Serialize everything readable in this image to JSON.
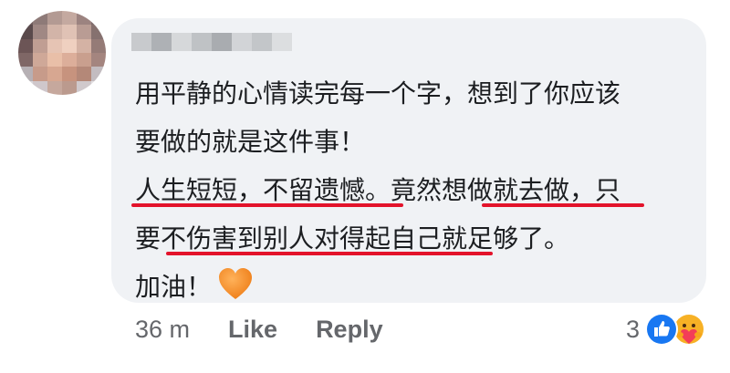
{
  "comment": {
    "lines": [
      "用平静的心情读完每一个字，想到了你应该",
      "要做的就是这件事！",
      "人生短短，不留遗憾。竟然想做就去做，只",
      "要不伤害到别人对得起自己就足够了。",
      "加油！"
    ],
    "heart_emoji": "orange-heart"
  },
  "footer": {
    "time": "36 m",
    "like_label": "Like",
    "reply_label": "Reply"
  },
  "reactions": {
    "count": "3",
    "types": [
      "like-icon",
      "care-icon"
    ]
  },
  "colors": {
    "bubble": "#f0f2f5",
    "underline": "#e3132b",
    "text": "#1c1e21",
    "meta": "#65676b",
    "like_blue": "#1877f2",
    "heart": "#f08a24"
  }
}
